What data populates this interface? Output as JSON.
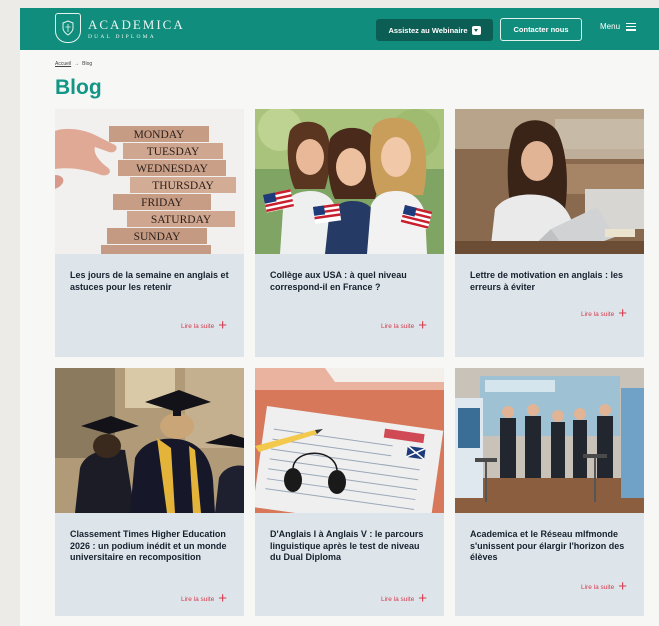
{
  "header": {
    "logo_name": "ACADEMICA",
    "logo_sub": "DUAL DIPLOMA",
    "webinar_label": "Assistez au Webinaire",
    "contact_label": "Contacter nous",
    "menu_label": "Menu"
  },
  "breadcrumb": {
    "home": "Accueil",
    "separator": "→",
    "current": "Blog"
  },
  "page_title": "Blog",
  "cards": [
    {
      "title": "Les jours de la semaine en anglais et astuces pour les retenir",
      "more": "Lire la suite",
      "image": "weekday-blocks",
      "days": [
        "MONDAY",
        "TUESDAY",
        "WEDNESDAY",
        "THURSDAY",
        "FRIDAY",
        "SATURDAY",
        "SUNDAY"
      ]
    },
    {
      "title": "Collège aux USA : à quel niveau correspond-il en France ?",
      "more": "Lire la suite",
      "image": "students-with-flags"
    },
    {
      "title": "Lettre de motivation en anglais : les erreurs à éviter",
      "more": "Lire la suite",
      "image": "student-laptop"
    },
    {
      "title": "Classement Times Higher Education 2026 : un podium inédit et un monde universitaire en recomposition",
      "more": "Lire la suite",
      "image": "graduates"
    },
    {
      "title": "D'Anglais I à Anglais V : le parcours linguistique après le test de niveau du Dual Diploma",
      "more": "Lire la suite",
      "image": "english-test-sheet"
    },
    {
      "title": "Academica et le Réseau mlfmonde s'unissent pour élargir l'horizon des élèves",
      "more": "Lire la suite",
      "image": "partners-group"
    }
  ],
  "colors": {
    "brand": "#108d7c",
    "brand_dark": "#0c5e55",
    "title": "#129685",
    "card_bg": "#dde5ea",
    "accent": "#d83a4d"
  }
}
